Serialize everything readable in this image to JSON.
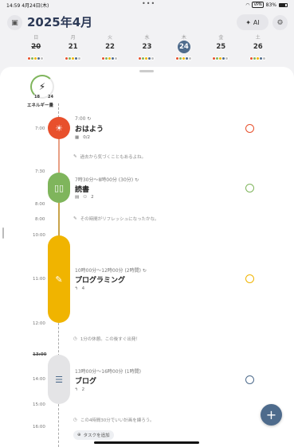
{
  "status": {
    "time": "14:59",
    "date": "4月24日(木)",
    "dots": "•••",
    "wifi": "wifi-icon",
    "vpn": "VPN",
    "battery": "83%"
  },
  "header": {
    "title": "2025年4月",
    "ai_label": "AI"
  },
  "week": [
    {
      "wd": "日",
      "num": "20",
      "strike": true
    },
    {
      "wd": "月",
      "num": "21"
    },
    {
      "wd": "火",
      "num": "22"
    },
    {
      "wd": "水",
      "num": "23"
    },
    {
      "wd": "木",
      "num": "24",
      "today": true
    },
    {
      "wd": "金",
      "num": "25"
    },
    {
      "wd": "土",
      "num": "26"
    }
  ],
  "dot_colors": [
    "#e8502c",
    "#7fb55c",
    "#f0b400",
    "#4e6b8c",
    "#c0c0c0"
  ],
  "energy": {
    "left": "18",
    "right": "24",
    "label": "エネルギー量"
  },
  "time_labels": [
    "7:00",
    "7:30",
    "8:00",
    "8:00",
    "10:00",
    "11:00",
    "12:00",
    "13:00",
    "14:00",
    "15:00",
    "16:00"
  ],
  "events": [
    {
      "time": "7:00",
      "title": "おはよう",
      "sub": "0/2",
      "color": "#e8502c"
    },
    {
      "time": "7時30分〜8時00分 (30分)",
      "title": "読書",
      "sub": "2",
      "color": "#7fb55c"
    },
    {
      "time": "10時00分〜12時00分 (2時間)",
      "title": "プログラミング",
      "sub": "4",
      "color": "#f0b400"
    },
    {
      "time": "13時00分〜16時00分 (1時間)",
      "title": "ブログ",
      "sub": "2",
      "color": "#4e6b8c"
    }
  ],
  "notes": [
    "過去から気づくこともあるよね。",
    "その時間がリフレッシュになったかな。",
    "1分の休憩。この後すぐ出発！",
    "この4時間30分でいい計画を練ろう。"
  ],
  "add_task": "タスクを追加",
  "fab": "+"
}
